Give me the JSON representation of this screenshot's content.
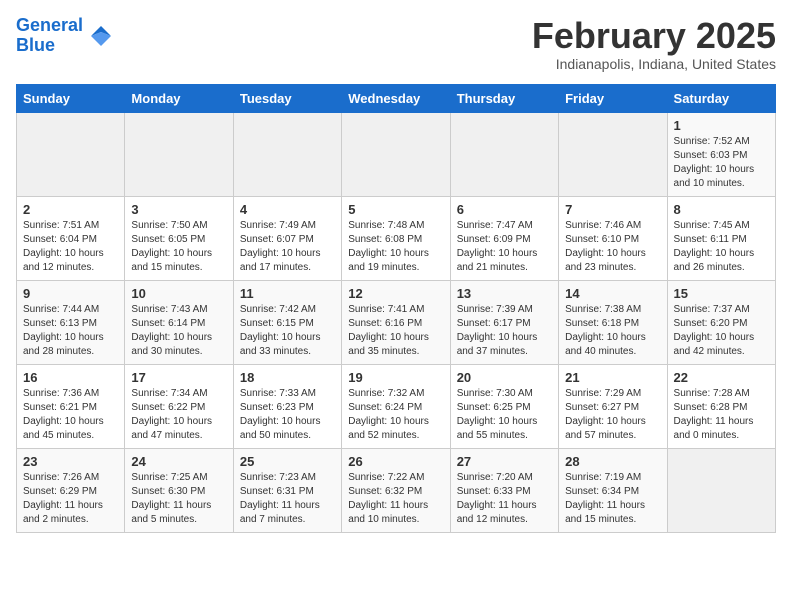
{
  "header": {
    "logo_line1": "General",
    "logo_line2": "Blue",
    "month_title": "February 2025",
    "location": "Indianapolis, Indiana, United States"
  },
  "weekdays": [
    "Sunday",
    "Monday",
    "Tuesday",
    "Wednesday",
    "Thursday",
    "Friday",
    "Saturday"
  ],
  "weeks": [
    [
      {
        "day": "",
        "info": ""
      },
      {
        "day": "",
        "info": ""
      },
      {
        "day": "",
        "info": ""
      },
      {
        "day": "",
        "info": ""
      },
      {
        "day": "",
        "info": ""
      },
      {
        "day": "",
        "info": ""
      },
      {
        "day": "1",
        "info": "Sunrise: 7:52 AM\nSunset: 6:03 PM\nDaylight: 10 hours\nand 10 minutes."
      }
    ],
    [
      {
        "day": "2",
        "info": "Sunrise: 7:51 AM\nSunset: 6:04 PM\nDaylight: 10 hours\nand 12 minutes."
      },
      {
        "day": "3",
        "info": "Sunrise: 7:50 AM\nSunset: 6:05 PM\nDaylight: 10 hours\nand 15 minutes."
      },
      {
        "day": "4",
        "info": "Sunrise: 7:49 AM\nSunset: 6:07 PM\nDaylight: 10 hours\nand 17 minutes."
      },
      {
        "day": "5",
        "info": "Sunrise: 7:48 AM\nSunset: 6:08 PM\nDaylight: 10 hours\nand 19 minutes."
      },
      {
        "day": "6",
        "info": "Sunrise: 7:47 AM\nSunset: 6:09 PM\nDaylight: 10 hours\nand 21 minutes."
      },
      {
        "day": "7",
        "info": "Sunrise: 7:46 AM\nSunset: 6:10 PM\nDaylight: 10 hours\nand 23 minutes."
      },
      {
        "day": "8",
        "info": "Sunrise: 7:45 AM\nSunset: 6:11 PM\nDaylight: 10 hours\nand 26 minutes."
      }
    ],
    [
      {
        "day": "9",
        "info": "Sunrise: 7:44 AM\nSunset: 6:13 PM\nDaylight: 10 hours\nand 28 minutes."
      },
      {
        "day": "10",
        "info": "Sunrise: 7:43 AM\nSunset: 6:14 PM\nDaylight: 10 hours\nand 30 minutes."
      },
      {
        "day": "11",
        "info": "Sunrise: 7:42 AM\nSunset: 6:15 PM\nDaylight: 10 hours\nand 33 minutes."
      },
      {
        "day": "12",
        "info": "Sunrise: 7:41 AM\nSunset: 6:16 PM\nDaylight: 10 hours\nand 35 minutes."
      },
      {
        "day": "13",
        "info": "Sunrise: 7:39 AM\nSunset: 6:17 PM\nDaylight: 10 hours\nand 37 minutes."
      },
      {
        "day": "14",
        "info": "Sunrise: 7:38 AM\nSunset: 6:18 PM\nDaylight: 10 hours\nand 40 minutes."
      },
      {
        "day": "15",
        "info": "Sunrise: 7:37 AM\nSunset: 6:20 PM\nDaylight: 10 hours\nand 42 minutes."
      }
    ],
    [
      {
        "day": "16",
        "info": "Sunrise: 7:36 AM\nSunset: 6:21 PM\nDaylight: 10 hours\nand 45 minutes."
      },
      {
        "day": "17",
        "info": "Sunrise: 7:34 AM\nSunset: 6:22 PM\nDaylight: 10 hours\nand 47 minutes."
      },
      {
        "day": "18",
        "info": "Sunrise: 7:33 AM\nSunset: 6:23 PM\nDaylight: 10 hours\nand 50 minutes."
      },
      {
        "day": "19",
        "info": "Sunrise: 7:32 AM\nSunset: 6:24 PM\nDaylight: 10 hours\nand 52 minutes."
      },
      {
        "day": "20",
        "info": "Sunrise: 7:30 AM\nSunset: 6:25 PM\nDaylight: 10 hours\nand 55 minutes."
      },
      {
        "day": "21",
        "info": "Sunrise: 7:29 AM\nSunset: 6:27 PM\nDaylight: 10 hours\nand 57 minutes."
      },
      {
        "day": "22",
        "info": "Sunrise: 7:28 AM\nSunset: 6:28 PM\nDaylight: 11 hours\nand 0 minutes."
      }
    ],
    [
      {
        "day": "23",
        "info": "Sunrise: 7:26 AM\nSunset: 6:29 PM\nDaylight: 11 hours\nand 2 minutes."
      },
      {
        "day": "24",
        "info": "Sunrise: 7:25 AM\nSunset: 6:30 PM\nDaylight: 11 hours\nand 5 minutes."
      },
      {
        "day": "25",
        "info": "Sunrise: 7:23 AM\nSunset: 6:31 PM\nDaylight: 11 hours\nand 7 minutes."
      },
      {
        "day": "26",
        "info": "Sunrise: 7:22 AM\nSunset: 6:32 PM\nDaylight: 11 hours\nand 10 minutes."
      },
      {
        "day": "27",
        "info": "Sunrise: 7:20 AM\nSunset: 6:33 PM\nDaylight: 11 hours\nand 12 minutes."
      },
      {
        "day": "28",
        "info": "Sunrise: 7:19 AM\nSunset: 6:34 PM\nDaylight: 11 hours\nand 15 minutes."
      },
      {
        "day": "",
        "info": ""
      }
    ]
  ]
}
